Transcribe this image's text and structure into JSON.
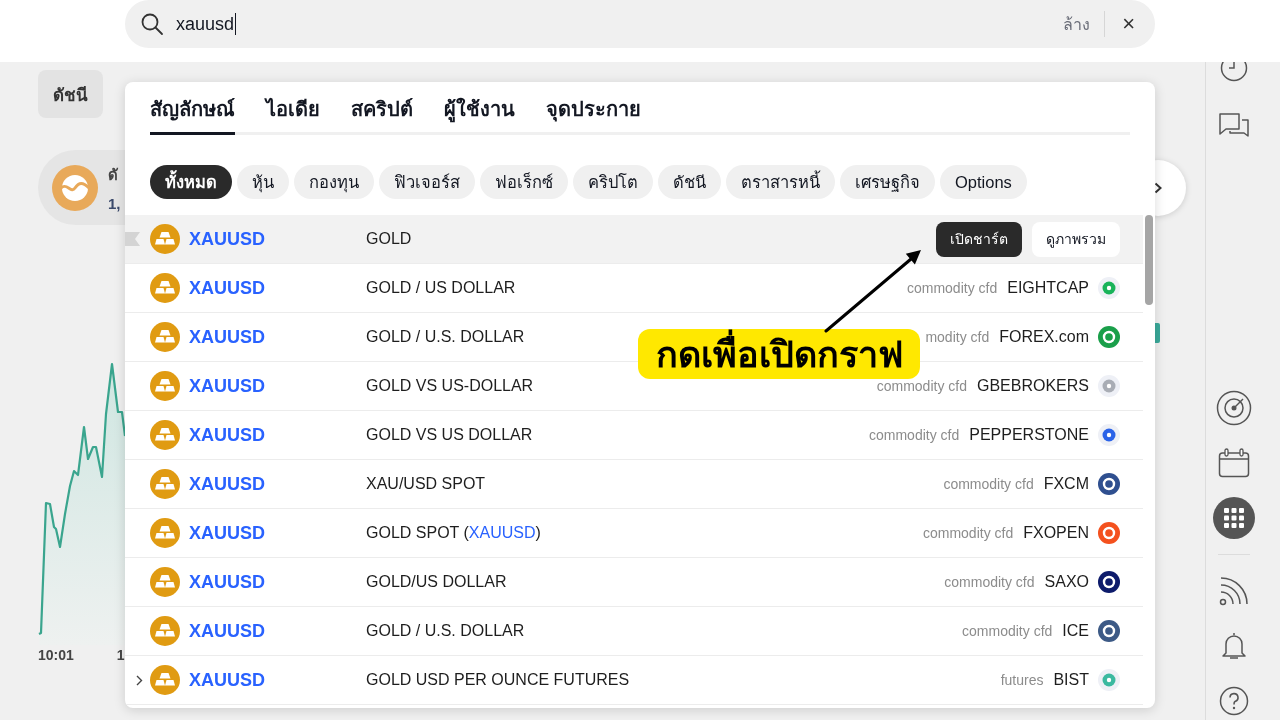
{
  "search": {
    "value": "xauusd",
    "clear_label": "ล้าง",
    "close_glyph": "×"
  },
  "page": {
    "category_tab": "ดัชนี",
    "card": {
      "title": "ดั",
      "value": "1,"
    },
    "time_labels": [
      "10:01",
      "1"
    ]
  },
  "dropdown": {
    "tabs": [
      {
        "label": "สัญลักษณ์",
        "selected": true
      },
      {
        "label": "ไอเดีย",
        "selected": false
      },
      {
        "label": "สคริปต์",
        "selected": false
      },
      {
        "label": "ผู้ใช้งาน",
        "selected": false
      },
      {
        "label": "จุดประกาย",
        "selected": false
      }
    ],
    "filters": [
      {
        "label": "ทั้งหมด",
        "selected": true
      },
      {
        "label": "หุ้น",
        "selected": false
      },
      {
        "label": "กองทุน",
        "selected": false
      },
      {
        "label": "ฟิวเจอร์ส",
        "selected": false
      },
      {
        "label": "ฟอเร็กซ์",
        "selected": false
      },
      {
        "label": "คริปโต",
        "selected": false
      },
      {
        "label": "ดัชนี",
        "selected": false
      },
      {
        "label": "ตราสารหนี้",
        "selected": false
      },
      {
        "label": "เศรษฐกิจ",
        "selected": false
      },
      {
        "label": "Options",
        "selected": false
      }
    ],
    "results": [
      {
        "symbol": "XAUUSD",
        "description": "GOLD",
        "hovered": true,
        "expandable": false,
        "actions": [
          {
            "label": "เปิดชาร์ต",
            "kind": "primary"
          },
          {
            "label": "ดูภาพรวม",
            "kind": "secondary"
          }
        ]
      },
      {
        "symbol": "XAUUSD",
        "description": "GOLD / US DOLLAR",
        "type": "commodity cfd",
        "exchange": "EIGHTCAP",
        "logo": {
          "kind": "tinted",
          "color": "#19b35a"
        },
        "hovered": false,
        "expandable": false
      },
      {
        "symbol": "XAUUSD",
        "description": "GOLD / U.S. DOLLAR",
        "type": "modity cfd",
        "exchange": "FOREX.com",
        "logo": {
          "kind": "solid",
          "color": "#1a9f4a"
        },
        "hovered": false,
        "expandable": false
      },
      {
        "symbol": "XAUUSD",
        "description": "GOLD VS US-DOLLAR",
        "type": "commodity cfd",
        "exchange": "GBEBROKERS",
        "logo": {
          "kind": "tinted",
          "color": "#a9adb5"
        },
        "hovered": false,
        "expandable": false
      },
      {
        "symbol": "XAUUSD",
        "description": "GOLD VS US DOLLAR",
        "type": "commodity cfd",
        "exchange": "PEPPERSTONE",
        "logo": {
          "kind": "tinted",
          "color": "#2b63e8"
        },
        "hovered": false,
        "expandable": false
      },
      {
        "symbol": "XAUUSD",
        "description": "XAU/USD SPOT",
        "type": "commodity cfd",
        "exchange": "FXCM",
        "logo": {
          "kind": "solid",
          "color": "#2f4f8f"
        },
        "hovered": false,
        "expandable": false
      },
      {
        "symbol": "XAUUSD",
        "description": "GOLD SPOT (**XAUUSD**)",
        "type": "commodity cfd",
        "exchange": "FXOPEN",
        "logo": {
          "kind": "solid",
          "color": "#f4511e"
        },
        "hovered": false,
        "expandable": false
      },
      {
        "symbol": "XAUUSD",
        "description": "GOLD/US DOLLAR",
        "type": "commodity cfd",
        "exchange": "SAXO",
        "logo": {
          "kind": "solid",
          "color": "#0d1b6b"
        },
        "hovered": false,
        "expandable": false
      },
      {
        "symbol": "XAUUSD",
        "description": "GOLD / U.S. DOLLAR",
        "type": "commodity cfd",
        "exchange": "ICE",
        "logo": {
          "kind": "solid",
          "color": "#3d5a86"
        },
        "hovered": false,
        "expandable": false
      },
      {
        "symbol": "XAUUSD",
        "description": "GOLD USD PER OUNCE FUTURES",
        "type": "futures",
        "exchange": "BIST",
        "logo": {
          "kind": "tinted",
          "color": "#3bb9a0"
        },
        "hovered": false,
        "expandable": true
      }
    ]
  },
  "callout": {
    "text": "กดเพื่อเปิดกราฟ"
  }
}
